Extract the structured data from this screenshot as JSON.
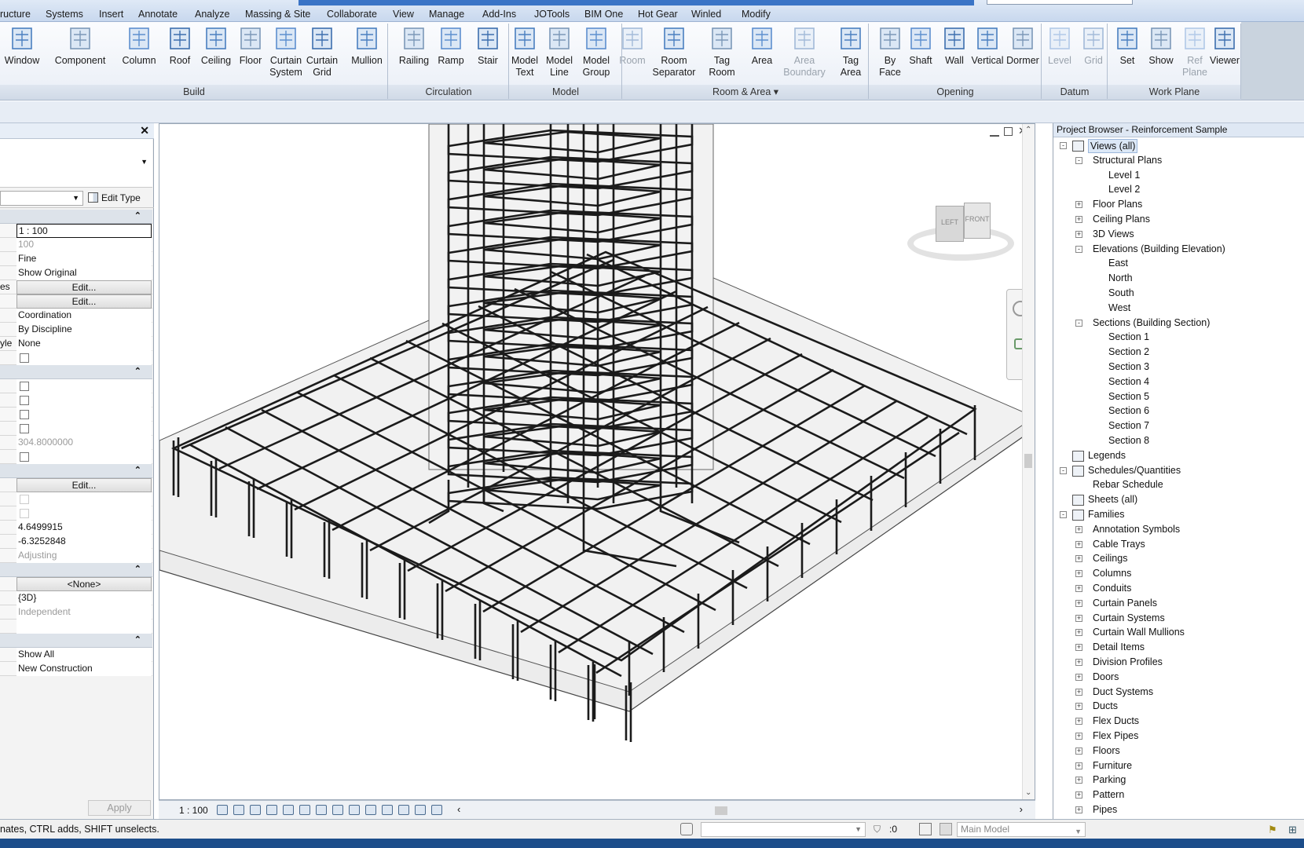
{
  "menu": [
    "ructure",
    "Systems",
    "Insert",
    "Annotate",
    "Analyze",
    "Massing & Site",
    "Collaborate",
    "View",
    "Manage",
    "Add-Ins",
    "JOTools",
    "BIM One",
    "Hot Gear",
    "Winled",
    "Modify"
  ],
  "ribbon": {
    "buttons": [
      {
        "label": "Window",
        "icon": "window-icon"
      },
      {
        "label": "Component",
        "icon": "component-icon"
      },
      {
        "label": "Column",
        "icon": "column-icon"
      },
      {
        "label": "Roof",
        "icon": "roof-icon"
      },
      {
        "label": "Ceiling",
        "icon": "ceiling-icon"
      },
      {
        "label": "Floor",
        "icon": "floor-icon"
      },
      {
        "label": "Curtain\nSystem",
        "icon": "curtain-system-icon"
      },
      {
        "label": "Curtain\nGrid",
        "icon": "curtain-grid-icon"
      },
      {
        "label": "Mullion",
        "icon": "mullion-icon"
      },
      {
        "label": "Railing",
        "icon": "railing-icon"
      },
      {
        "label": "Ramp",
        "icon": "ramp-icon"
      },
      {
        "label": "Stair",
        "icon": "stair-icon"
      },
      {
        "label": "Model\nText",
        "icon": "model-text-icon"
      },
      {
        "label": "Model\nLine",
        "icon": "model-line-icon"
      },
      {
        "label": "Model\nGroup",
        "icon": "model-group-icon"
      },
      {
        "label": "Room",
        "icon": "room-icon",
        "disabled": true
      },
      {
        "label": "Room\nSeparator",
        "icon": "room-separator-icon"
      },
      {
        "label": "Tag\nRoom",
        "icon": "tag-room-icon"
      },
      {
        "label": "Area",
        "icon": "area-icon"
      },
      {
        "label": "Area\nBoundary",
        "icon": "area-boundary-icon",
        "disabled": true
      },
      {
        "label": "Tag\nArea",
        "icon": "tag-area-icon"
      },
      {
        "label": "By\nFace",
        "icon": "by-face-icon"
      },
      {
        "label": "Shaft",
        "icon": "shaft-icon"
      },
      {
        "label": "Wall",
        "icon": "wall-opening-icon"
      },
      {
        "label": "Vertical",
        "icon": "vertical-opening-icon"
      },
      {
        "label": "Dormer",
        "icon": "dormer-icon"
      },
      {
        "label": "Level",
        "icon": "level-icon",
        "disabled": true
      },
      {
        "label": "Grid",
        "icon": "grid-icon",
        "disabled": true
      },
      {
        "label": "Set",
        "icon": "set-workplane-icon"
      },
      {
        "label": "Show",
        "icon": "show-workplane-icon"
      },
      {
        "label": "Ref\nPlane",
        "icon": "ref-plane-icon",
        "disabled": true
      },
      {
        "label": "Viewer",
        "icon": "viewer-icon"
      }
    ],
    "panels": [
      "Build",
      "Circulation",
      "Model",
      "Room & Area ▾",
      "Opening",
      "Datum",
      "Work Plane"
    ]
  },
  "properties": {
    "edit_type": "Edit Type",
    "apply": "Apply",
    "rows": [
      {
        "kind": "grp"
      },
      {
        "kind": "val",
        "cut": "",
        "value": "1 : 100",
        "style": "sel"
      },
      {
        "kind": "val",
        "cut": "",
        "value": "100",
        "style": "grey"
      },
      {
        "kind": "val",
        "cut": "",
        "value": "Fine"
      },
      {
        "kind": "val",
        "cut": "",
        "value": "Show Original"
      },
      {
        "kind": "val",
        "cut": "es",
        "value": "Edit...",
        "style": "btn"
      },
      {
        "kind": "val",
        "cut": "",
        "value": "Edit...",
        "style": "btn"
      },
      {
        "kind": "val",
        "cut": "",
        "value": "Coordination"
      },
      {
        "kind": "val",
        "cut": "",
        "value": "By Discipline"
      },
      {
        "kind": "val",
        "cut": "yle",
        "value": "None"
      },
      {
        "kind": "chk"
      },
      {
        "kind": "grp"
      },
      {
        "kind": "chk"
      },
      {
        "kind": "chk"
      },
      {
        "kind": "chk"
      },
      {
        "kind": "chk"
      },
      {
        "kind": "val",
        "cut": "",
        "value": "304.8000000",
        "style": "grey"
      },
      {
        "kind": "chk"
      },
      {
        "kind": "grp"
      },
      {
        "kind": "val",
        "cut": "",
        "value": "Edit...",
        "style": "btn"
      },
      {
        "kind": "chk",
        "dim": true
      },
      {
        "kind": "chk",
        "dim": true
      },
      {
        "kind": "val",
        "cut": "",
        "value": "4.6499915"
      },
      {
        "kind": "val",
        "cut": "",
        "value": "-6.3252848"
      },
      {
        "kind": "val",
        "cut": "",
        "value": "Adjusting",
        "style": "grey"
      },
      {
        "kind": "grp"
      },
      {
        "kind": "val",
        "cut": "",
        "value": "<None>",
        "style": "btn"
      },
      {
        "kind": "val",
        "cut": "",
        "value": "{3D}"
      },
      {
        "kind": "val",
        "cut": "",
        "value": "Independent",
        "style": "grey"
      },
      {
        "kind": "val",
        "cut": "",
        "value": ""
      },
      {
        "kind": "grp"
      },
      {
        "kind": "val",
        "cut": "",
        "value": "Show All"
      },
      {
        "kind": "val",
        "cut": "",
        "value": "New Construction"
      }
    ]
  },
  "viewport": {
    "scale": "1 : 100",
    "viewcube_left": "LEFT",
    "viewcube_front": "FRONT"
  },
  "browser": {
    "title": "Project Browser - Reinforcement Sample",
    "tree": [
      {
        "label": "Views (all)",
        "level": 0,
        "exp": "-",
        "icon": true,
        "selected": true
      },
      {
        "label": "Structural Plans",
        "level": 1,
        "exp": "-"
      },
      {
        "label": "Level 1",
        "level": 2
      },
      {
        "label": "Level 2",
        "level": 2
      },
      {
        "label": "Floor Plans",
        "level": 1,
        "exp": "+"
      },
      {
        "label": "Ceiling Plans",
        "level": 1,
        "exp": "+"
      },
      {
        "label": "3D Views",
        "level": 1,
        "exp": "+"
      },
      {
        "label": "Elevations (Building Elevation)",
        "level": 1,
        "exp": "-"
      },
      {
        "label": "East",
        "level": 2
      },
      {
        "label": "North",
        "level": 2
      },
      {
        "label": "South",
        "level": 2
      },
      {
        "label": "West",
        "level": 2
      },
      {
        "label": "Sections (Building Section)",
        "level": 1,
        "exp": "-"
      },
      {
        "label": "Section 1",
        "level": 2
      },
      {
        "label": "Section 2",
        "level": 2
      },
      {
        "label": "Section 3",
        "level": 2
      },
      {
        "label": "Section 4",
        "level": 2
      },
      {
        "label": "Section 5",
        "level": 2
      },
      {
        "label": "Section 6",
        "level": 2
      },
      {
        "label": "Section 7",
        "level": 2
      },
      {
        "label": "Section 8",
        "level": 2
      },
      {
        "label": "Legends",
        "level": 0,
        "icon": true
      },
      {
        "label": "Schedules/Quantities",
        "level": 0,
        "exp": "-",
        "icon": true
      },
      {
        "label": "Rebar Schedule",
        "level": 1
      },
      {
        "label": "Sheets (all)",
        "level": 0,
        "icon": true
      },
      {
        "label": "Families",
        "level": 0,
        "exp": "-",
        "icon": true
      },
      {
        "label": "Annotation Symbols",
        "level": 1,
        "exp": "+"
      },
      {
        "label": "Cable Trays",
        "level": 1,
        "exp": "+"
      },
      {
        "label": "Ceilings",
        "level": 1,
        "exp": "+"
      },
      {
        "label": "Columns",
        "level": 1,
        "exp": "+"
      },
      {
        "label": "Conduits",
        "level": 1,
        "exp": "+"
      },
      {
        "label": "Curtain Panels",
        "level": 1,
        "exp": "+"
      },
      {
        "label": "Curtain Systems",
        "level": 1,
        "exp": "+"
      },
      {
        "label": "Curtain Wall Mullions",
        "level": 1,
        "exp": "+"
      },
      {
        "label": "Detail Items",
        "level": 1,
        "exp": "+"
      },
      {
        "label": "Division Profiles",
        "level": 1,
        "exp": "+"
      },
      {
        "label": "Doors",
        "level": 1,
        "exp": "+"
      },
      {
        "label": "Duct Systems",
        "level": 1,
        "exp": "+"
      },
      {
        "label": "Ducts",
        "level": 1,
        "exp": "+"
      },
      {
        "label": "Flex Ducts",
        "level": 1,
        "exp": "+"
      },
      {
        "label": "Flex Pipes",
        "level": 1,
        "exp": "+"
      },
      {
        "label": "Floors",
        "level": 1,
        "exp": "+"
      },
      {
        "label": "Furniture",
        "level": 1,
        "exp": "+"
      },
      {
        "label": "Parking",
        "level": 1,
        "exp": "+"
      },
      {
        "label": "Pattern",
        "level": 1,
        "exp": "+"
      },
      {
        "label": "Pipes",
        "level": 1,
        "exp": "+"
      }
    ]
  },
  "status": {
    "hint": "nates, CTRL adds, SHIFT unselects.",
    "count": ":0",
    "model": "Main Model"
  },
  "colors": {
    "accent": "#3a74c6",
    "taskbar": "#1c4d8a"
  }
}
